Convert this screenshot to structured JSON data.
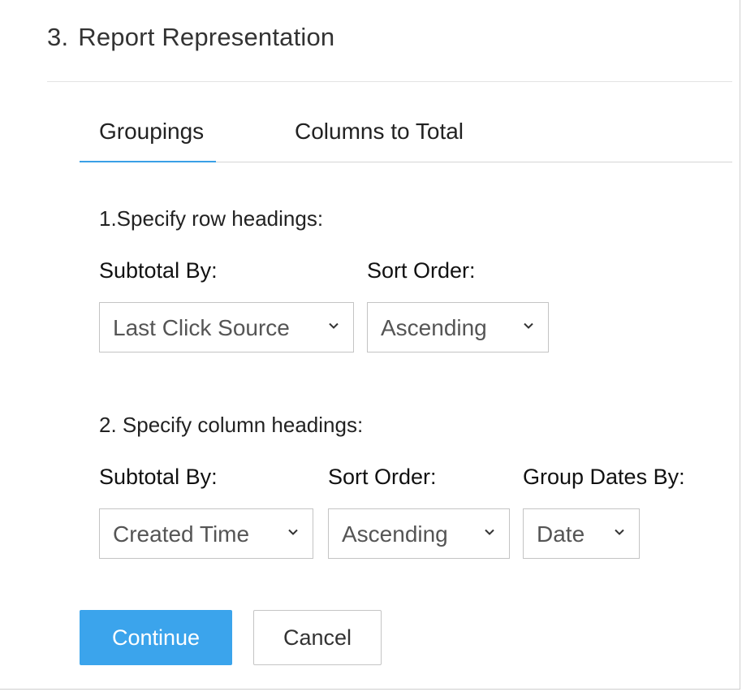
{
  "header": {
    "step_number": "3.",
    "title": "Report Representation"
  },
  "tabs": [
    {
      "label": "Groupings",
      "active": true
    },
    {
      "label": "Columns to Total",
      "active": false
    }
  ],
  "colors": {
    "accent": "#3ba4ec",
    "tab_underline": "#3aa0e6",
    "border": "#c4c4c4"
  },
  "row_headings": {
    "heading": "1.Specify row headings:",
    "subtotal_label": "Subtotal By:",
    "subtotal_value": "Last Click Source",
    "sort_label": "Sort Order:",
    "sort_value": "Ascending"
  },
  "column_headings": {
    "heading": "2. Specify column headings:",
    "subtotal_label": "Subtotal By:",
    "subtotal_value": "Created Time",
    "sort_label": "Sort Order:",
    "sort_value": "Ascending",
    "group_dates_label": "Group Dates By:",
    "group_dates_value": "Date"
  },
  "actions": {
    "continue_label": "Continue",
    "cancel_label": "Cancel"
  }
}
